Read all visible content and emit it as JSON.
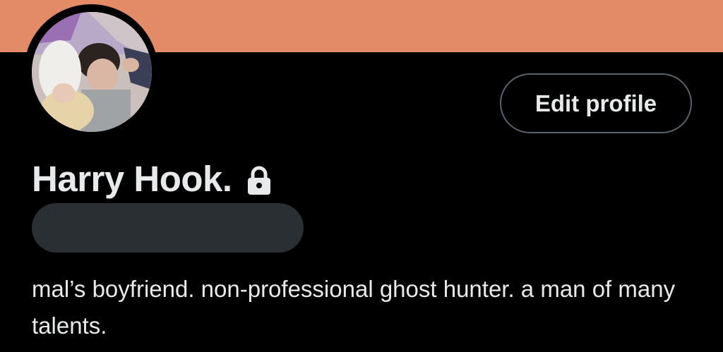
{
  "profile": {
    "banner_color": "#e38a66",
    "display_name": "Harry Hook.",
    "protected_icon": "lock-icon",
    "handle_redacted": true,
    "bio": "mal’s boyfriend. non-professional ghost hunter. a man of many talents."
  },
  "actions": {
    "edit_profile_label": "Edit profile"
  },
  "theme": {
    "background": "#000000",
    "text": "#e7e9ea",
    "button_border": "#5b6168",
    "redaction": "#2a2f34"
  }
}
